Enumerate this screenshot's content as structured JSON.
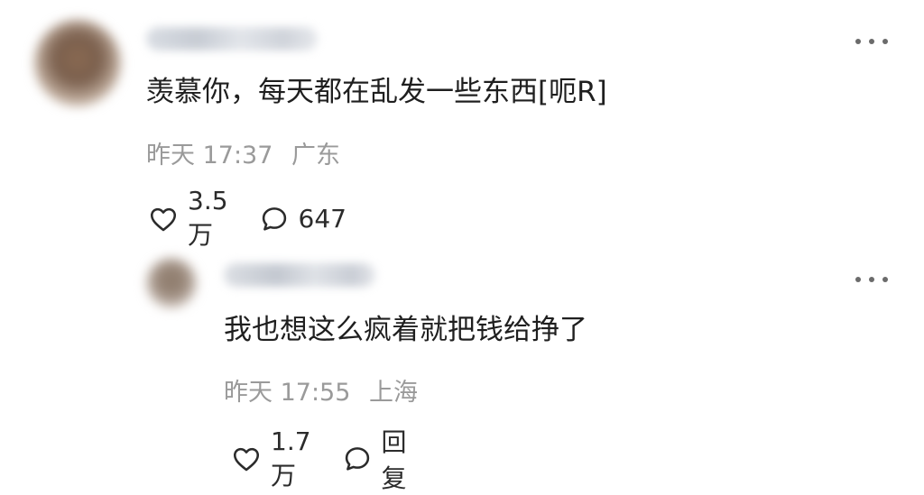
{
  "comment": {
    "content": "羡慕你，每天都在乱发一些东西[呃R]",
    "time": "昨天 17:37",
    "location": "广东",
    "likes": "3.5万",
    "replies": "647"
  },
  "reply": {
    "content": "我也想这么疯着就把钱给挣了",
    "time": "昨天 17:55",
    "location": "上海",
    "likes": "1.7万",
    "reply_label": "回复"
  }
}
